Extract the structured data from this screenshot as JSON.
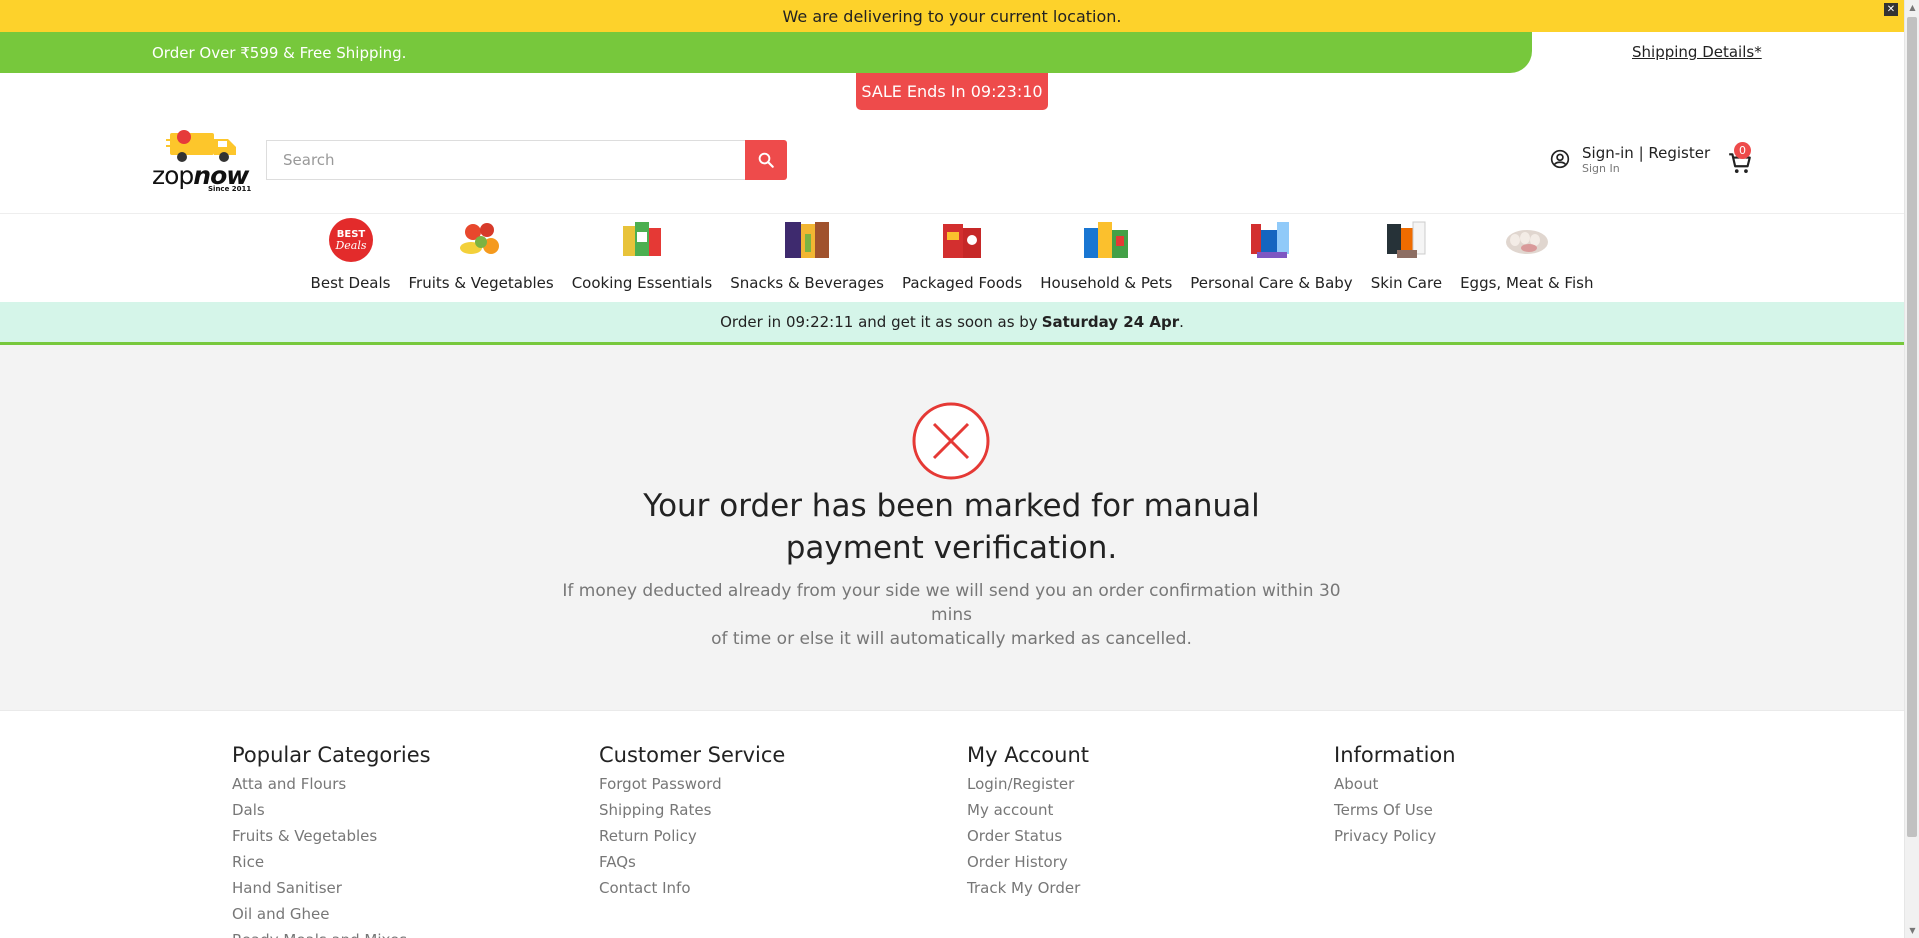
{
  "location_bar": {
    "text": "We are delivering to your current location.",
    "close": "✕"
  },
  "promo_bar": {
    "text": "Order Over ₹599 & Free Shipping.",
    "shipping_details": "Shipping Details*"
  },
  "sale_badge": "SALE Ends In 09:23:10",
  "logo": {
    "brand_plain": "zop",
    "brand_bold": "now",
    "since": "Since 2011"
  },
  "search": {
    "placeholder": "Search",
    "value": ""
  },
  "account": {
    "title": "Sign-in | Register",
    "subtitle": "Sign In"
  },
  "cart": {
    "count": "0"
  },
  "categories": [
    {
      "label": "Best Deals",
      "icon": "best-deals-icon"
    },
    {
      "label": "Fruits & Vegetables",
      "icon": "fruits-icon"
    },
    {
      "label": "Cooking Essentials",
      "icon": "cooking-icon"
    },
    {
      "label": "Snacks & Beverages",
      "icon": "snacks-icon"
    },
    {
      "label": "Packaged Foods",
      "icon": "packaged-icon"
    },
    {
      "label": "Household & Pets",
      "icon": "household-icon"
    },
    {
      "label": "Personal Care & Baby",
      "icon": "personal-care-icon"
    },
    {
      "label": "Skin Care",
      "icon": "skin-care-icon"
    },
    {
      "label": "Eggs, Meat & Fish",
      "icon": "eggs-icon"
    }
  ],
  "delivery": {
    "prefix": "Order in 09:22:11 and get it as soon as by",
    "date": "Saturday 24 Apr",
    "suffix": "."
  },
  "order_status": {
    "title_line1": "Your order has been marked for manual",
    "title_line2": "payment verification.",
    "message_line1": "If money deducted already from your side we will send you an order confirmation within 30",
    "message_line2": "mins",
    "message_line3": "of time or else it will automatically marked as cancelled."
  },
  "footer": {
    "columns": [
      {
        "heading": "Popular Categories",
        "links": [
          "Atta and Flours",
          "Dals",
          "Fruits & Vegetables",
          "Rice",
          "Hand Sanitiser",
          "Oil and Ghee",
          "Ready Meals and Mixes"
        ]
      },
      {
        "heading": "Customer Service",
        "links": [
          "Forgot Password",
          "Shipping Rates",
          "Return Policy",
          "FAQs",
          "Contact Info"
        ]
      },
      {
        "heading": "My Account",
        "links": [
          "Login/Register",
          "My account",
          "Order Status",
          "Order History",
          "Track My Order"
        ]
      },
      {
        "heading": "Information",
        "links": [
          "About",
          "Terms Of Use",
          "Privacy Policy"
        ]
      }
    ]
  },
  "colors": {
    "yellow": "#fdd22b",
    "green": "#77c83c",
    "red": "#ee4b4b",
    "mint": "#d5f5e9"
  }
}
